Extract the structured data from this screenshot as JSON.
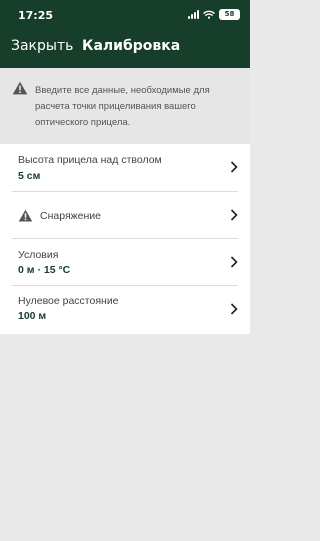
{
  "status_bar": {
    "time": "17:25",
    "battery": "58",
    "icons": [
      "signal-icon",
      "wifi-icon",
      "battery-icon"
    ]
  },
  "nav": {
    "close_label": "Закрыть",
    "title": "Калибровка"
  },
  "notice": {
    "icon": "warning-icon",
    "text": "Введите все данные, необходимые для расчета точки прицеливания вашего оптического прицела."
  },
  "settings": {
    "items": [
      {
        "label": "Высота прицела над стволом",
        "value": "5 см"
      },
      {
        "label": "Снаряжение",
        "icon": "warning-icon"
      },
      {
        "label": "Условия",
        "value": "0 м · 15 °C"
      },
      {
        "label": "Нулевое расстояние",
        "value": "100 м"
      }
    ]
  },
  "colors": {
    "header_bg": "#173d2b",
    "accent": "#173d2b",
    "page_bg": "#e9e9e9"
  }
}
